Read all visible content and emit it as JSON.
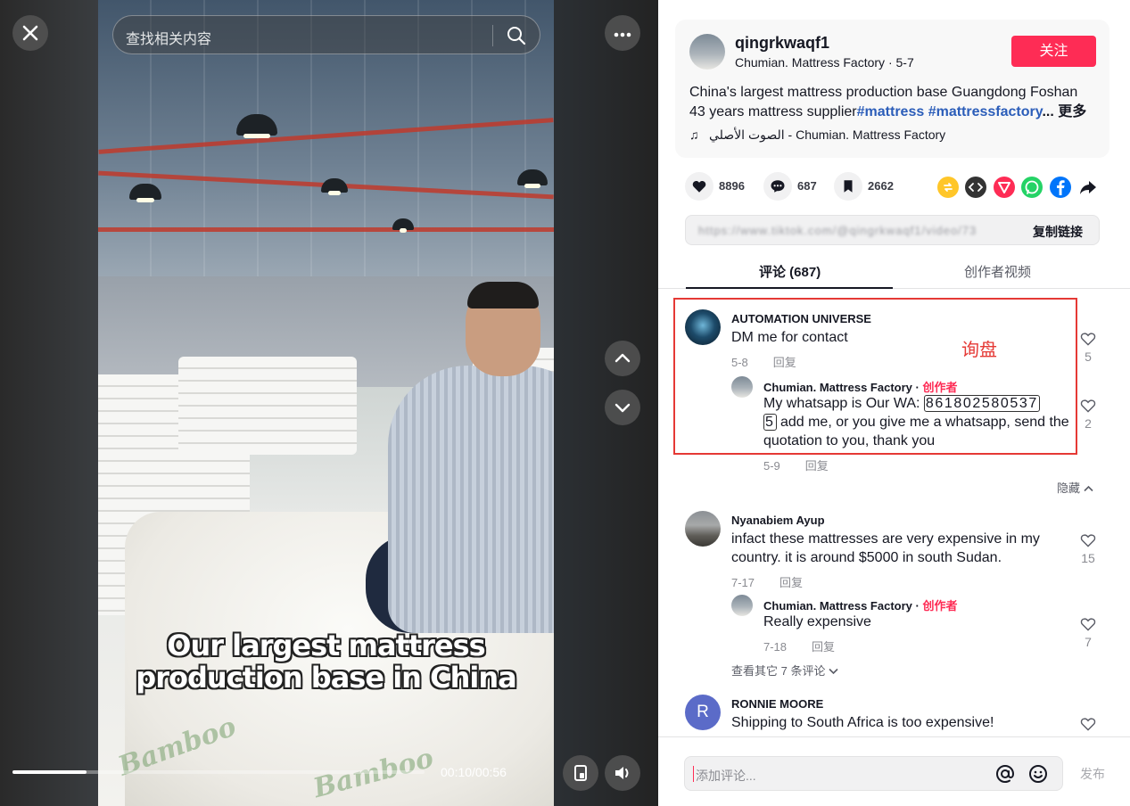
{
  "video": {
    "search_placeholder": "查找相关内容",
    "caption_line1": "Our largest mattress",
    "caption_line2": "production base in China",
    "time": "00:10/00:56",
    "progress": 0.18,
    "watermark": "Bamboo"
  },
  "author": {
    "username": "qingrkwaqf1",
    "subline": "Chumian. Mattress Factory · 5-7",
    "follow_label": "关注",
    "desc_line1": "China's largest mattress production base Guangdong Foshan",
    "desc_line2": "43 years mattress supplier",
    "tag1": "#mattress",
    "tag2": "#mattressfactory",
    "more": "... 更多",
    "music": "الصوت الأصلي - Chumian. Mattress Factory"
  },
  "stats": {
    "likes": "8896",
    "comments": "687",
    "saves": "2662"
  },
  "share_icons": [
    "repost-icon",
    "embed-icon",
    "send-icon",
    "whatsapp-icon",
    "facebook-icon",
    "share-arrow-icon"
  ],
  "link": {
    "url": "https://www.tiktok.com/@qingrkwaqf1/video/73",
    "copy_label": "复制链接"
  },
  "tabs": {
    "comments": "评论 (687)",
    "creator_videos": "创作者视频"
  },
  "comments": [
    {
      "name": "AUTOMATION UNIVERSE",
      "text": "DM me for contact",
      "date": "5-8",
      "reply": "回复",
      "likes": "5",
      "replies": [
        {
          "name": "Chumian. Mattress Factory · ",
          "creator": "创作者",
          "text_pre": "My whatsapp is Our WA: ",
          "wa1": "861802580537",
          "wa2": "5",
          "text_post": " add me, or you give me a whatsapp, send the quotation to you, thank you",
          "date": "5-9",
          "reply": "回复",
          "likes": "2"
        }
      ]
    },
    {
      "name": "Nyanabiem Ayup",
      "text": "infact these mattresses are very expensive in my country. it is around $5000 in south Sudan.",
      "date": "7-17",
      "reply": "回复",
      "likes": "15",
      "replies": [
        {
          "name": "Chumian. Mattress Factory · ",
          "creator": "创作者",
          "text": "Really expensive",
          "date": "7-18",
          "reply": "回复",
          "likes": "7"
        }
      ]
    },
    {
      "name": "RONNIE MOORE",
      "initial": "R",
      "text": "Shipping to South Africa is too expensive!"
    }
  ],
  "hide_label": "隐藏",
  "view_more_label": "查看其它 7 条评论",
  "annotation": "询盘",
  "footer": {
    "placeholder": "添加评论...",
    "post_label": "发布"
  },
  "colors": {
    "accent": "#fe2c55",
    "hashtag": "#2b5db9",
    "annotation": "#e53935"
  }
}
